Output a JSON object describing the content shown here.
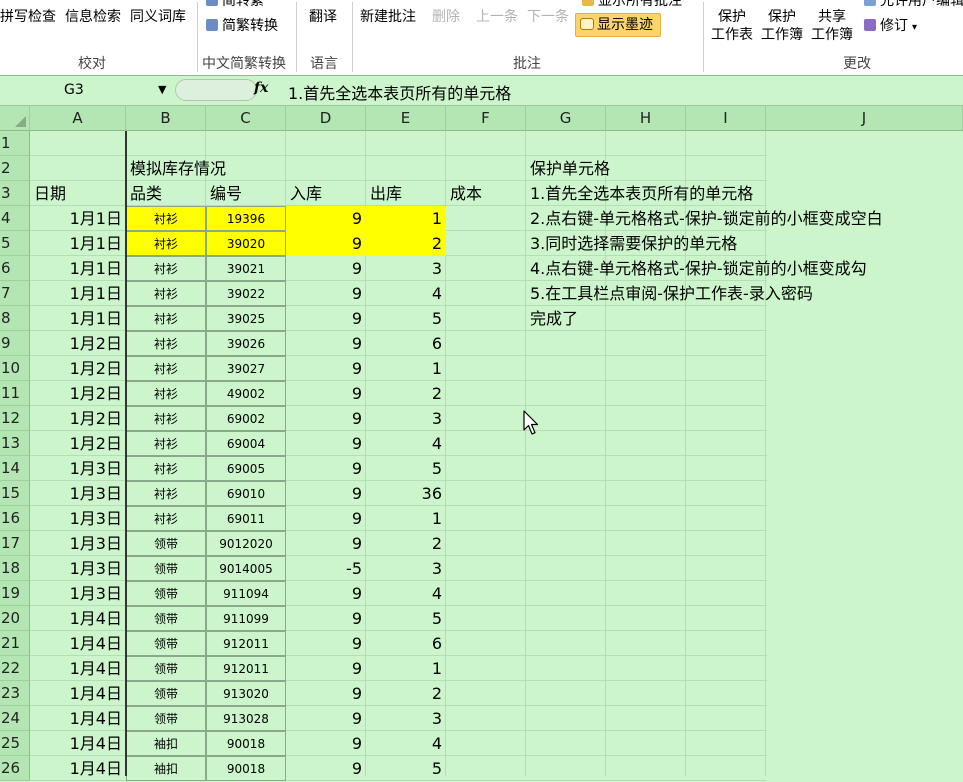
{
  "ribbon": {
    "proofing_buttons": [
      "拼写检查",
      "信息检索",
      "同义词库"
    ],
    "proofing_label": "校对",
    "chinese_buttons": [
      "简转繁",
      "简繁转换"
    ],
    "chinese_label": "中文简繁转换",
    "language_button": "翻译",
    "language_label": "语言",
    "comment_buttons": {
      "new": "新建批注",
      "delete": "删除",
      "prev": "上一条",
      "next": "下一条",
      "show_all": "显示所有批注",
      "ink": "显示墨迹"
    },
    "comment_label": "批注",
    "change_buttons": {
      "protect_sheet": [
        "保护",
        "工作表"
      ],
      "protect_book": [
        "保护",
        "工作簿"
      ],
      "share_book": [
        "共享",
        "工作簿"
      ],
      "allow_edit": "允许用户编辑",
      "track": "修订"
    },
    "change_label": "更改"
  },
  "formula_bar": {
    "name_box": "G3",
    "fx": "fx",
    "content": "1.首先全选本表页所有的单元格"
  },
  "columns": [
    "A",
    "B",
    "C",
    "D",
    "E",
    "F",
    "G",
    "H",
    "I",
    "J"
  ],
  "rows": [
    {
      "n": "1",
      "A": "",
      "B": "",
      "C": "",
      "D": "",
      "E": "",
      "F": "",
      "G": ""
    },
    {
      "n": "2",
      "A": "",
      "B": "模拟库存情况",
      "C": "",
      "D": "",
      "E": "",
      "F": "",
      "G": "保护单元格"
    },
    {
      "n": "3",
      "A": "日期",
      "B": "品类",
      "C": "编号",
      "D": "入库",
      "E": "出库",
      "F": "成本",
      "G": "1.首先全选本表页所有的单元格"
    },
    {
      "n": "4",
      "A": "1月1日",
      "B": "衬衫",
      "C": "19396",
      "D": "9",
      "E": "1",
      "F": "",
      "G": "2.点右键-单元格格式-保护-锁定前的小框变成空白"
    },
    {
      "n": "5",
      "A": "1月1日",
      "B": "衬衫",
      "C": "39020",
      "D": "9",
      "E": "2",
      "F": "",
      "G": "3.同时选择需要保护的单元格"
    },
    {
      "n": "6",
      "A": "1月1日",
      "B": "衬衫",
      "C": "39021",
      "D": "9",
      "E": "3",
      "F": "",
      "G": "4.点右键-单元格格式-保护-锁定前的小框变成勾"
    },
    {
      "n": "7",
      "A": "1月1日",
      "B": "衬衫",
      "C": "39022",
      "D": "9",
      "E": "4",
      "F": "",
      "G": "5.在工具栏点审阅-保护工作表-录入密码"
    },
    {
      "n": "8",
      "A": "1月1日",
      "B": "衬衫",
      "C": "39025",
      "D": "9",
      "E": "5",
      "F": "",
      "G": "完成了"
    },
    {
      "n": "9",
      "A": "1月2日",
      "B": "衬衫",
      "C": "39026",
      "D": "9",
      "E": "6",
      "F": "",
      "G": ""
    },
    {
      "n": "10",
      "A": "1月2日",
      "B": "衬衫",
      "C": "39027",
      "D": "9",
      "E": "1",
      "F": "",
      "G": ""
    },
    {
      "n": "11",
      "A": "1月2日",
      "B": "衬衫",
      "C": "49002",
      "D": "9",
      "E": "2",
      "F": "",
      "G": ""
    },
    {
      "n": "12",
      "A": "1月2日",
      "B": "衬衫",
      "C": "69002",
      "D": "9",
      "E": "3",
      "F": "",
      "G": ""
    },
    {
      "n": "13",
      "A": "1月2日",
      "B": "衬衫",
      "C": "69004",
      "D": "9",
      "E": "4",
      "F": "",
      "G": ""
    },
    {
      "n": "14",
      "A": "1月3日",
      "B": "衬衫",
      "C": "69005",
      "D": "9",
      "E": "5",
      "F": "",
      "G": ""
    },
    {
      "n": "15",
      "A": "1月3日",
      "B": "衬衫",
      "C": "69010",
      "D": "9",
      "E": "36",
      "F": "",
      "G": ""
    },
    {
      "n": "16",
      "A": "1月3日",
      "B": "衬衫",
      "C": "69011",
      "D": "9",
      "E": "1",
      "F": "",
      "G": ""
    },
    {
      "n": "17",
      "A": "1月3日",
      "B": "领带",
      "C": "9012020",
      "D": "9",
      "E": "2",
      "F": "",
      "G": ""
    },
    {
      "n": "18",
      "A": "1月3日",
      "B": "领带",
      "C": "9014005",
      "D": "-5",
      "E": "3",
      "F": "",
      "G": ""
    },
    {
      "n": "19",
      "A": "1月3日",
      "B": "领带",
      "C": "911094",
      "D": "9",
      "E": "4",
      "F": "",
      "G": ""
    },
    {
      "n": "20",
      "A": "1月4日",
      "B": "领带",
      "C": "911099",
      "D": "9",
      "E": "5",
      "F": "",
      "G": ""
    },
    {
      "n": "21",
      "A": "1月4日",
      "B": "领带",
      "C": "912011",
      "D": "9",
      "E": "6",
      "F": "",
      "G": ""
    },
    {
      "n": "22",
      "A": "1月4日",
      "B": "领带",
      "C": "912011",
      "D": "9",
      "E": "1",
      "F": "",
      "G": ""
    },
    {
      "n": "23",
      "A": "1月4日",
      "B": "领带",
      "C": "913020",
      "D": "9",
      "E": "2",
      "F": "",
      "G": ""
    },
    {
      "n": "24",
      "A": "1月4日",
      "B": "领带",
      "C": "913028",
      "D": "9",
      "E": "3",
      "F": "",
      "G": ""
    },
    {
      "n": "25",
      "A": "1月4日",
      "B": "袖扣",
      "C": "90018",
      "D": "9",
      "E": "4",
      "F": "",
      "G": ""
    },
    {
      "n": "26",
      "A": "1月4日",
      "B": "袖扣",
      "C": "90018",
      "D": "9",
      "E": "5",
      "F": "",
      "G": ""
    }
  ],
  "colors": {
    "sheet_bg": "#ccf5cc",
    "header_bg": "#b3e6b3",
    "highlight": "#ffff00",
    "ink_button": "#fbd56a"
  }
}
